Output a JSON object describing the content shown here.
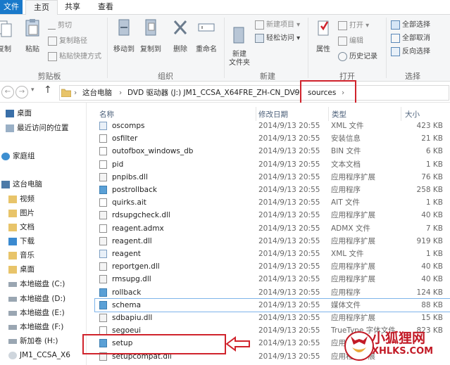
{
  "tabs": {
    "file": "文件",
    "home": "主页",
    "share": "共享",
    "view": "查看"
  },
  "ribbon": {
    "clipboard": {
      "label": "剪贴板",
      "copy": "复制",
      "paste": "粘贴",
      "cut": "剪切",
      "copy_path": "复制路径",
      "paste_shortcut": "粘贴快捷方式"
    },
    "organize": {
      "label": "组织",
      "move_to": "移动到",
      "copy_to": "复制到",
      "delete": "删除",
      "rename": "重命名"
    },
    "new": {
      "label": "新建",
      "new_folder": "新建\n文件夹",
      "new_item": "新建项目",
      "easy_access": "轻松访问"
    },
    "open": {
      "label": "打开",
      "properties": "属性",
      "open": "打开",
      "edit": "编辑",
      "history": "历史记录"
    },
    "select": {
      "label": "选择",
      "select_all": "全部选择",
      "select_none": "全部取消",
      "invert": "反向选择"
    }
  },
  "address": {
    "crumbs": [
      "这台电脑",
      "DVD 驱动器 (J:) JM1_CCSA_X64FRE_ZH-CN_DV9",
      "sources"
    ]
  },
  "nav": {
    "items": [
      {
        "label": "桌面",
        "icon": "desktop-icon"
      },
      {
        "label": "最近访问的位置",
        "icon": "recent-icon"
      },
      {
        "label": "家庭组",
        "icon": "homegroup-icon"
      },
      {
        "label": "这台电脑",
        "icon": "computer-icon"
      },
      {
        "label": "视频",
        "icon": "folder-icon"
      },
      {
        "label": "图片",
        "icon": "folder-icon"
      },
      {
        "label": "文档",
        "icon": "folder-icon"
      },
      {
        "label": "下载",
        "icon": "download-icon"
      },
      {
        "label": "音乐",
        "icon": "music-icon"
      },
      {
        "label": "桌面",
        "icon": "folder-icon"
      },
      {
        "label": "本地磁盘 (C:)",
        "icon": "drive-icon"
      },
      {
        "label": "本地磁盘 (D:)",
        "icon": "drive-icon"
      },
      {
        "label": "本地磁盘 (E:)",
        "icon": "drive-icon"
      },
      {
        "label": "本地磁盘 (F:)",
        "icon": "drive-icon"
      },
      {
        "label": "新加卷 (H:)",
        "icon": "drive-icon"
      },
      {
        "label": "JM1_CCSA_X6",
        "icon": "dvd-icon"
      }
    ]
  },
  "columns": {
    "name": "名称",
    "date": "修改日期",
    "type": "类型",
    "size": "大小"
  },
  "files": [
    {
      "name": "oscomps",
      "date": "2014/9/13 20:55",
      "type": "XML 文件",
      "size": "423 KB",
      "kind": "xml"
    },
    {
      "name": "osfilter",
      "date": "2014/9/13 20:55",
      "type": "安装信息",
      "size": "21 KB",
      "kind": "file"
    },
    {
      "name": "outofbox_windows_db",
      "date": "2014/9/13 20:55",
      "type": "BIN 文件",
      "size": "6 KB",
      "kind": "file"
    },
    {
      "name": "pid",
      "date": "2014/9/13 20:55",
      "type": "文本文档",
      "size": "1 KB",
      "kind": "txt"
    },
    {
      "name": "pnpibs.dll",
      "date": "2014/9/13 20:55",
      "type": "应用程序扩展",
      "size": "76 KB",
      "kind": "dll"
    },
    {
      "name": "postrollback",
      "date": "2014/9/13 20:55",
      "type": "应用程序",
      "size": "258 KB",
      "kind": "exe"
    },
    {
      "name": "quirks.ait",
      "date": "2014/9/13 20:55",
      "type": "AIT 文件",
      "size": "1 KB",
      "kind": "file"
    },
    {
      "name": "rdsupgcheck.dll",
      "date": "2014/9/13 20:55",
      "type": "应用程序扩展",
      "size": "40 KB",
      "kind": "dll"
    },
    {
      "name": "reagent.admx",
      "date": "2014/9/13 20:55",
      "type": "ADMX 文件",
      "size": "7 KB",
      "kind": "file"
    },
    {
      "name": "reagent.dll",
      "date": "2014/9/13 20:55",
      "type": "应用程序扩展",
      "size": "919 KB",
      "kind": "dll"
    },
    {
      "name": "reagent",
      "date": "2014/9/13 20:55",
      "type": "XML 文件",
      "size": "1 KB",
      "kind": "xml"
    },
    {
      "name": "reportgen.dll",
      "date": "2014/9/13 20:55",
      "type": "应用程序扩展",
      "size": "40 KB",
      "kind": "dll"
    },
    {
      "name": "rmsupg.dll",
      "date": "2014/9/13 20:55",
      "type": "应用程序扩展",
      "size": "40 KB",
      "kind": "dll"
    },
    {
      "name": "rollback",
      "date": "2014/9/13 20:55",
      "type": "应用程序",
      "size": "124 KB",
      "kind": "exe"
    },
    {
      "name": "schema",
      "date": "2014/9/13 20:55",
      "type": "媒体文件",
      "size": "88 KB",
      "kind": "exe"
    },
    {
      "name": "sdbapiu.dll",
      "date": "2014/9/13 20:55",
      "type": "应用程序扩展",
      "size": "15 KB",
      "kind": "dll"
    },
    {
      "name": "segoeui",
      "date": "2014/9/13 20:55",
      "type": "TrueType 字体文件",
      "size": "823 KB",
      "kind": "font"
    },
    {
      "name": "setup",
      "date": "2014/9/13 20:55",
      "type": "应用程序",
      "size": "",
      "kind": "exe"
    },
    {
      "name": "setupcompat.dll",
      "date": "2014/9/13 20:55",
      "type": "应用程序扩展",
      "size": "",
      "kind": "dll"
    }
  ],
  "watermark": {
    "title": "小狐狸网",
    "url": "XHLKS.COM"
  },
  "colors": {
    "highlight": "#d0232c",
    "file_tab": "#1979ca",
    "selection": "#7eb4ea"
  }
}
